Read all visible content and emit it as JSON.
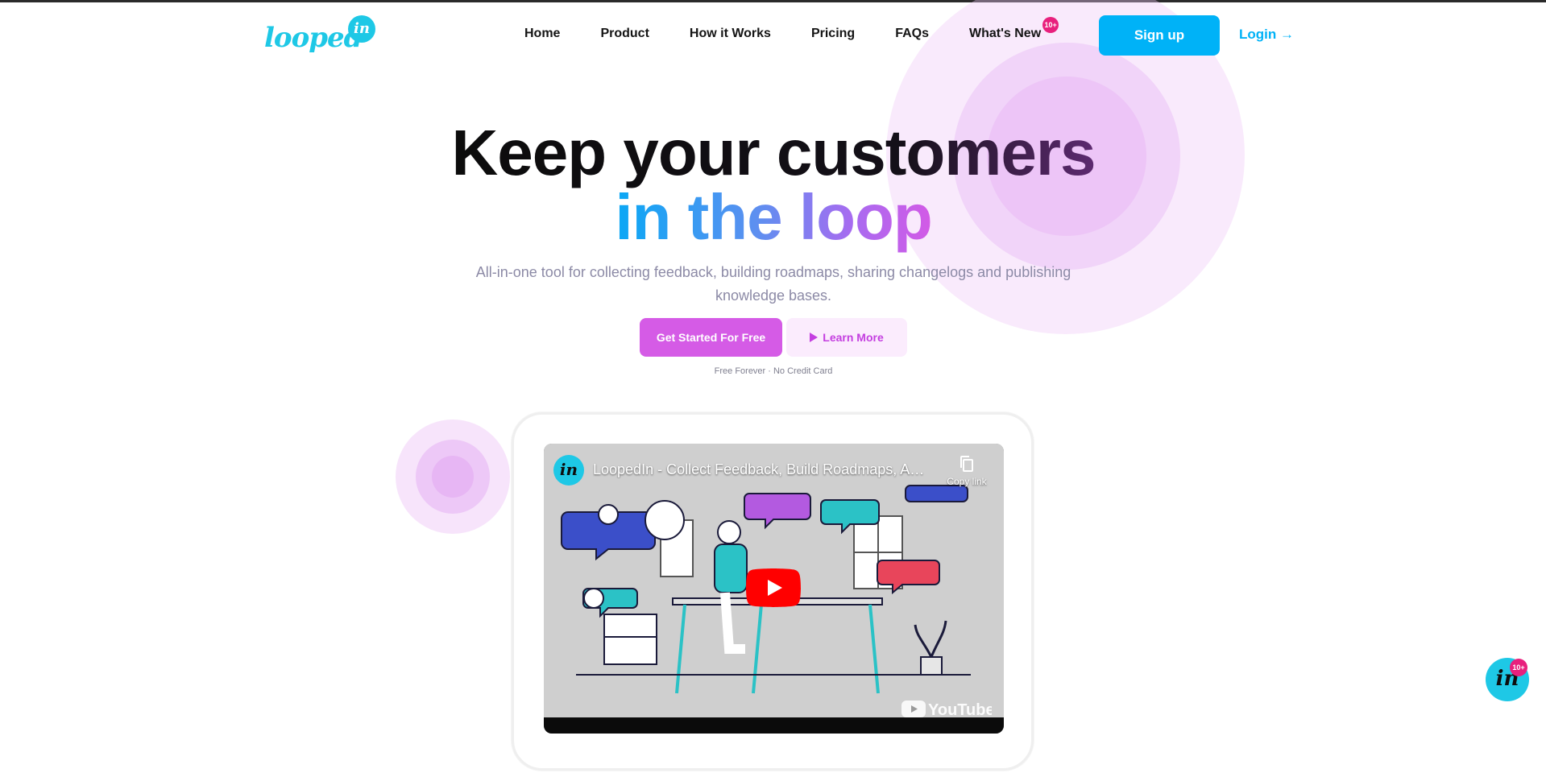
{
  "brand": {
    "logo_text": "looped",
    "logo_badge": "in"
  },
  "nav": {
    "items": [
      {
        "label": "Home"
      },
      {
        "label": "Product"
      },
      {
        "label": "How it Works"
      },
      {
        "label": "Pricing"
      },
      {
        "label": "FAQs"
      },
      {
        "label": "What's New",
        "badge": "10+"
      }
    ],
    "signup": "Sign up",
    "login": "Login →"
  },
  "hero": {
    "title_line1": "Keep your customers",
    "title_line2": "in the loop",
    "subtitle": "All-in-one tool for collecting feedback, building roadmaps, sharing changelogs and publishing knowledge bases.",
    "cta_primary": "Get Started For Free",
    "cta_secondary": "Learn More",
    "note": "Free Forever · No Credit Card"
  },
  "video": {
    "channel_avatar": "in",
    "title": "LoopedIn - Collect Feedback, Build Roadmaps, Ann...",
    "copy_link": "Copy link",
    "platform": "YouTube",
    "icons": {
      "copy": "copy-icon",
      "play": "play-icon",
      "logo": "youtube-logo-icon"
    }
  },
  "widget": {
    "label": "in",
    "badge": "10+"
  },
  "colors": {
    "accent_blue": "#00b2f7",
    "accent_pink": "#d55be6",
    "brand_cyan": "#1ec8e6",
    "badge_magenta": "#e8207d",
    "text_muted": "#8c8aa6"
  }
}
